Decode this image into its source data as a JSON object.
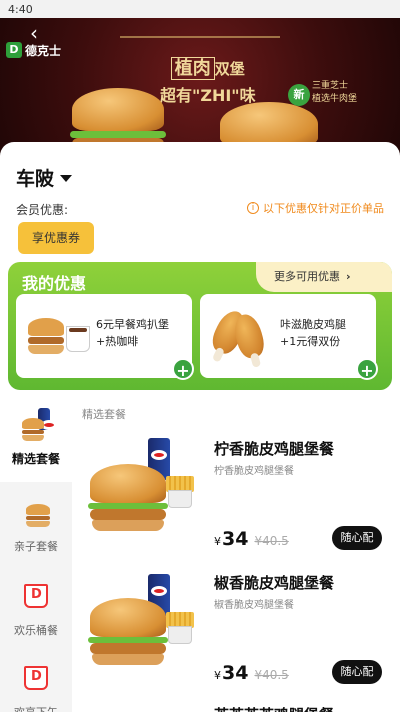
{
  "status_bar": {
    "time": "4:40"
  },
  "banner": {
    "brand": "德克士",
    "headline_boxed": "植肉",
    "headline_small": "双堡",
    "headline_line2": "超有\"ZHI\"味",
    "badge_circle": "新",
    "badge_lines": [
      "三重芝士",
      "植选牛肉堡"
    ]
  },
  "store": {
    "name": "车陂"
  },
  "member": {
    "label": "会员优惠:",
    "notice": "以下优惠仅针对正价单品",
    "enjoy_button": "享优惠券"
  },
  "deals": {
    "title": "我的优惠",
    "more_label": "更多可用优惠",
    "coupons": [
      {
        "line1": "6元早餐鸡扒堡",
        "line2": "+热咖啡"
      },
      {
        "line1": "咔滋脆皮鸡腿",
        "line2": "+1元得双份"
      }
    ]
  },
  "sidebar": {
    "items": [
      {
        "label": "精选套餐",
        "active": true
      },
      {
        "label": "亲子套餐",
        "active": false
      },
      {
        "label": "欢乐桶餐",
        "active": false
      },
      {
        "label": "欢享下午",
        "active": false
      }
    ]
  },
  "menu": {
    "section_label": "精选套餐",
    "products": [
      {
        "name": "柠香脆皮鸡腿堡餐",
        "sub": "柠香脆皮鸡腿堡餐",
        "currency": "¥",
        "price": "34",
        "old_price": "¥40.5",
        "button": "随心配"
      },
      {
        "name": "椒香脆皮鸡腿堡餐",
        "sub": "椒香脆皮鸡腿堡餐",
        "currency": "¥",
        "price": "34",
        "old_price": "¥40.5",
        "button": "随心配"
      },
      {
        "name": "芙芙芙芙鸡腿堡餐"
      }
    ]
  },
  "colors": {
    "accent_green": "#5fb831",
    "coupon_yellow": "#f6c13a",
    "notice_orange": "#f08a1c"
  }
}
